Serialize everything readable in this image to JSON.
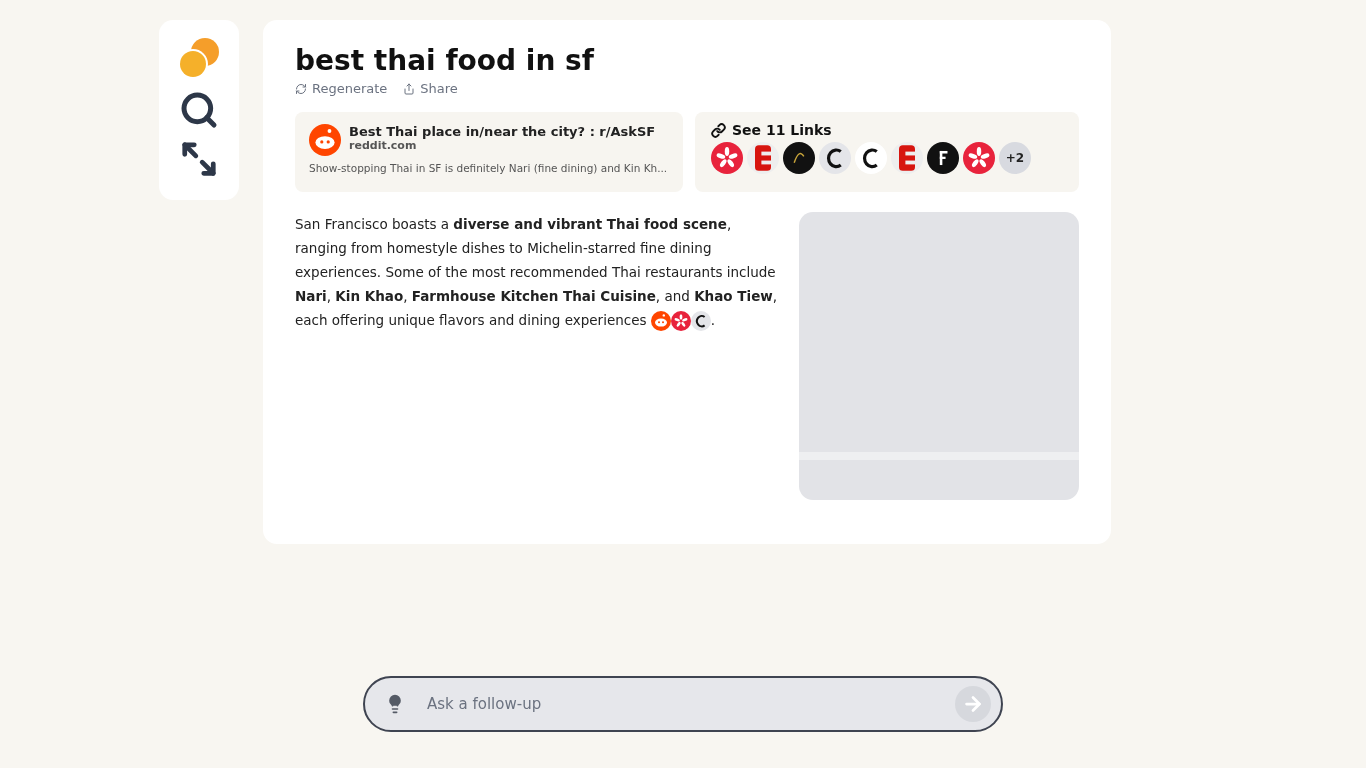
{
  "query": {
    "title": "best thai food in sf",
    "actions": [
      {
        "kind": "regenerate",
        "label": "Regenerate"
      },
      {
        "kind": "share",
        "label": "Share"
      }
    ]
  },
  "source_card": {
    "kind": "reddit",
    "title": "Best Thai place in/near the city? : r/AskSF",
    "domain": "reddit.com",
    "snippet": "Show-stopping Thai in SF is definitely Nari (fine dining) and Kin Kh..."
  },
  "links": {
    "label": "See 11 Links",
    "icons": [
      {
        "kind": "yelp"
      },
      {
        "kind": "eater"
      },
      {
        "kind": "fine"
      },
      {
        "kind": "chronicle-grey"
      },
      {
        "kind": "chronicle"
      },
      {
        "kind": "eater"
      },
      {
        "kind": "forbes"
      },
      {
        "kind": "yelp"
      }
    ],
    "more": "+2"
  },
  "answer": {
    "text": "San Francisco boasts a **diverse and vibrant Thai food scene**, ranging from homestyle dishes to Michelin-starred fine dining experiences. Some of the most recommended Thai restaurants include **Nari**, **Kin Khao**, **Farmhouse Kitchen Thai Cuisine**, and **Khao Tiew**, each offering unique flavors and dining experiences",
    "citations": [
      {
        "kind": "reddit"
      },
      {
        "kind": "yelp"
      },
      {
        "kind": "chronicle-grey"
      }
    ],
    "end": "."
  },
  "followup": {
    "placeholder": "Ask a follow-up"
  }
}
